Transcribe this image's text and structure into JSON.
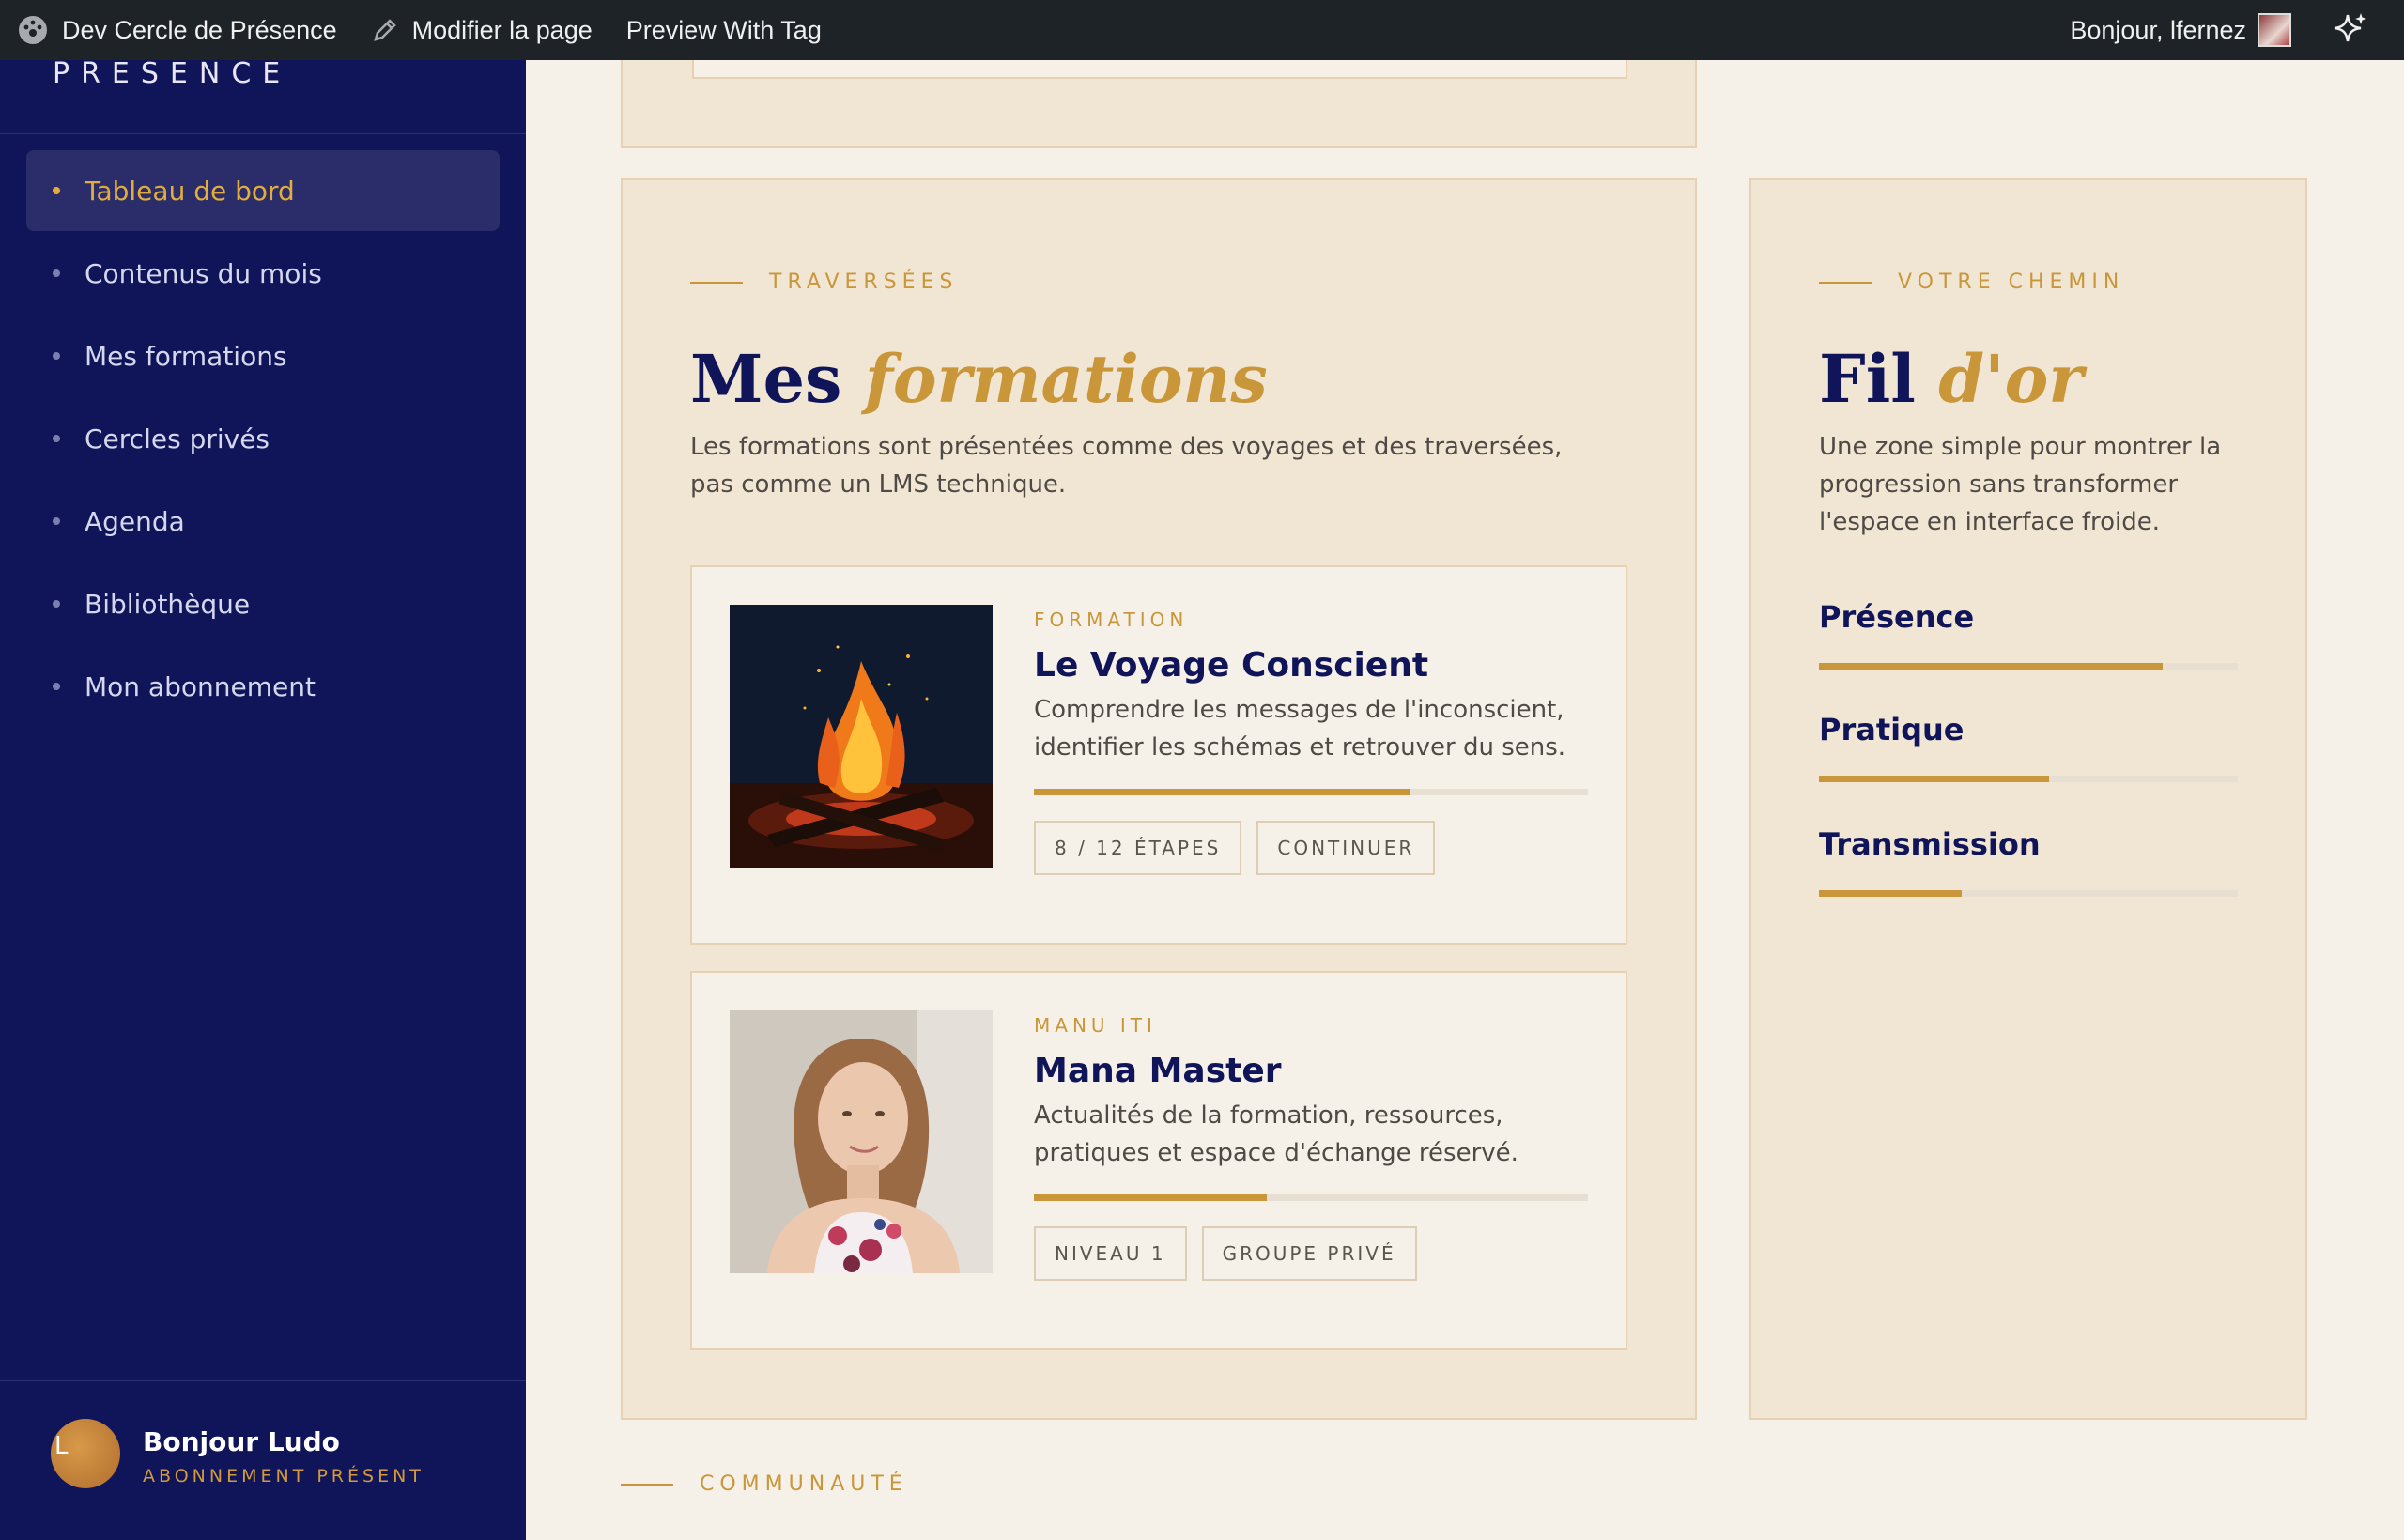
{
  "adminbar": {
    "site_name": "Dev Cercle de Présence",
    "edit_label": "Modifier la page",
    "preview_label": "Preview With Tag",
    "greeting": "Bonjour, lfernez"
  },
  "sidebar": {
    "brand": "PRÉSENCE",
    "items": [
      {
        "label": "Tableau de bord",
        "active": true
      },
      {
        "label": "Contenus du mois",
        "active": false
      },
      {
        "label": "Mes formations",
        "active": false
      },
      {
        "label": "Cercles privés",
        "active": false
      },
      {
        "label": "Agenda",
        "active": false
      },
      {
        "label": "Bibliothèque",
        "active": false
      },
      {
        "label": "Mon abonnement",
        "active": false
      }
    ],
    "user": {
      "initial": "L",
      "name": "Bonjour Ludo",
      "plan": "ABONNEMENT PRÉSENT"
    }
  },
  "formations": {
    "eyebrow": "TRAVERSÉES",
    "title_main": "Mes",
    "title_accent": "formations",
    "description": "Les formations sont présentées comme des voyages et des traversées, pas comme un LMS technique.",
    "cards": [
      {
        "tag": "FORMATION",
        "title": "Le Voyage Conscient",
        "description": "Comprendre les messages de l'inconscient, identifier les schémas et retrouver du sens.",
        "progress": 0.68,
        "chips": [
          "8 / 12 ÉTAPES",
          "CONTINUER"
        ]
      },
      {
        "tag": "MANU ITI",
        "title": "Mana Master",
        "description": "Actualités de la formation, ressources, pratiques et espace d'échange réservé.",
        "progress": 0.42,
        "chips": [
          "NIVEAU 1",
          "GROUPE PRIVÉ"
        ]
      }
    ]
  },
  "chemin": {
    "eyebrow": "VOTRE CHEMIN",
    "title_main": "Fil",
    "title_accent": "d'or",
    "description": "Une zone simple pour montrer la progression sans transformer l'espace en interface froide.",
    "tracks": [
      {
        "label": "Présence",
        "progress": 0.82
      },
      {
        "label": "Pratique",
        "progress": 0.55
      },
      {
        "label": "Transmission",
        "progress": 0.34
      }
    ]
  },
  "community": {
    "eyebrow": "COMMUNAUTÉ"
  },
  "colors": {
    "sidebar_bg": "#10155a",
    "accent_gold": "#c9973a",
    "panel_bg": "#f1e6d3",
    "page_bg": "#f6f1e8"
  }
}
